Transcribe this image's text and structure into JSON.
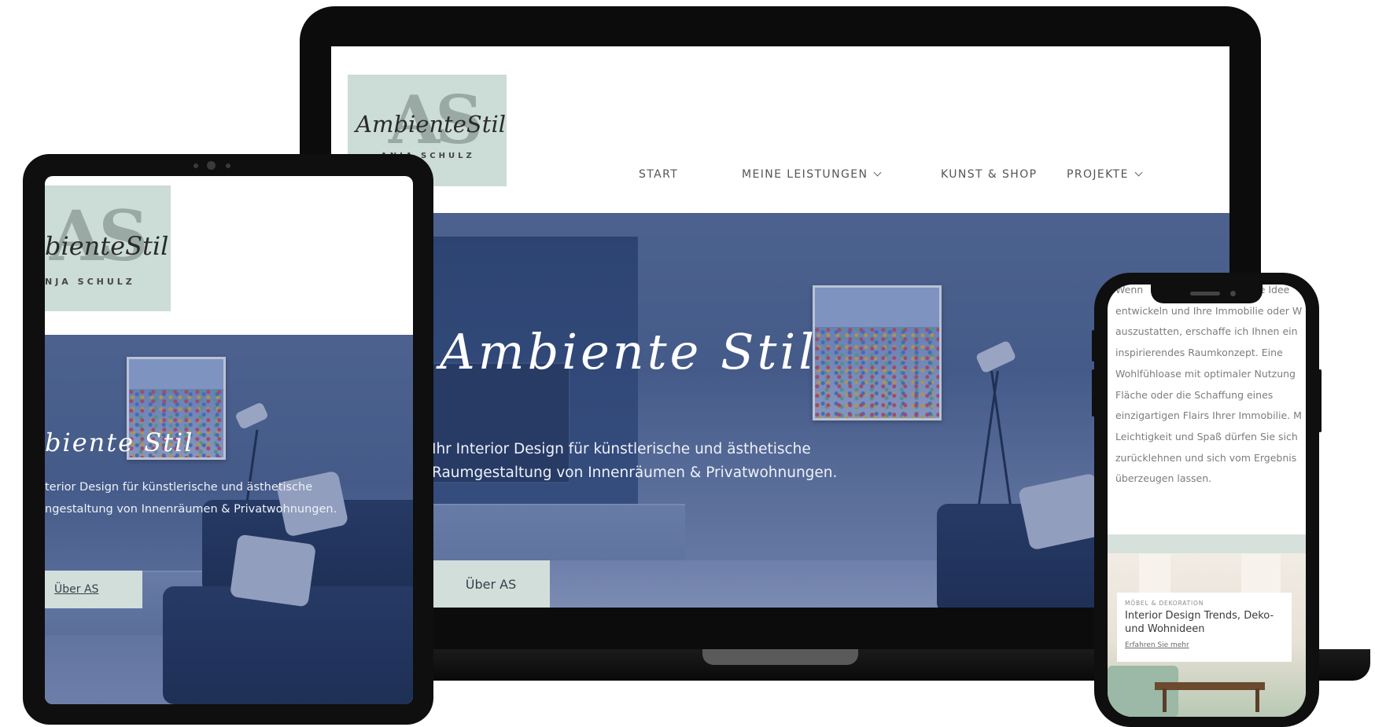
{
  "brand": {
    "logo_letters": "AS",
    "logo_script": "AmbienteStil",
    "logo_sub": "ANJA SCHULZ",
    "tablet_logo_script": "bienteStil",
    "tablet_logo_sub": "NJA SCHULZ"
  },
  "nav": {
    "items": [
      {
        "label": "START"
      },
      {
        "label": "MEINE LEISTUNGEN"
      },
      {
        "label": "KUNST & SHOP"
      },
      {
        "label": "PROJEKTE"
      }
    ]
  },
  "hero": {
    "title": "Ambiente Stil",
    "subtitle_line1": "Ihr Interior Design für künstlerische und ästhetische",
    "subtitle_line2": "Raumgestaltung von Innenräumen & Privatwohnungen.",
    "button": "Über AS"
  },
  "tablet_hero": {
    "title": "biente Stil",
    "subtitle_line1": "terior Design für künstlerische und ästhetische",
    "subtitle_line2": "ngestaltung von Innenräumen & Privatwohnungen.",
    "button": "Über AS"
  },
  "phone": {
    "text_lines": [
      "Wenn ",
      "entwickeln und Ihre Immobilie oder W",
      "auszustatten, erschaffe ich Ihnen ein",
      "inspirierendes Raumkonzept. Eine",
      "Wohlfühloase mit optimaler Nutzung",
      "Fläche oder die Schaffung eines",
      "einzigartigen Flairs Ihrer Immobilie. M",
      "Leichtigkeit und Spaß dürfen Sie sich",
      "zurücklehnen und sich vom Ergebnis",
      "überzeugen lassen."
    ],
    "text_line_end": "gene Idee",
    "card": {
      "category": "MÖBEL & DEKORATION",
      "title": "Interior Design Trends, Deko- und Wohnideen",
      "link": "Erfahren Sie mehr"
    }
  },
  "colors": {
    "logo_bg": "#ccdcd6",
    "button_bg": "#d2ded9",
    "hero_tint": "#4f6590",
    "device_frame": "#0c0c0c"
  },
  "icons": {
    "nav_dropdown": "chevron-down-icon"
  }
}
